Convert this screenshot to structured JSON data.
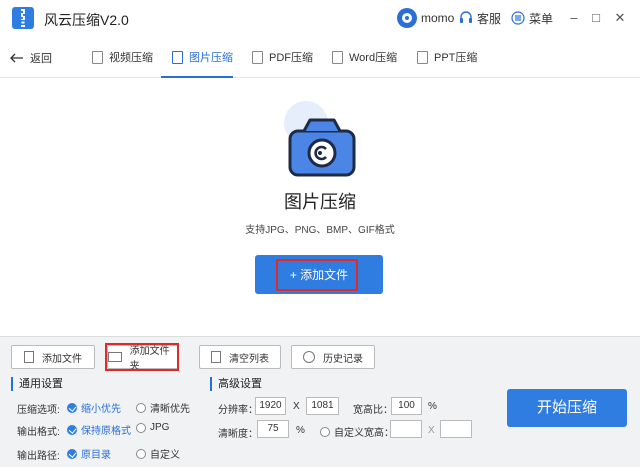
{
  "app": {
    "title": "风云压缩V2.0",
    "user": "momo",
    "service_label": "客服",
    "menu_label": "菜单",
    "minimize": "–",
    "maximize": "□",
    "close": "✕",
    "accent_color": "#2f7de1"
  },
  "tabs": {
    "back_label": "返回",
    "items": [
      {
        "label": "视频压缩",
        "icon": "video-file-icon"
      },
      {
        "label": "图片压缩",
        "icon": "image-file-icon",
        "active": true
      },
      {
        "label": "PDF压缩",
        "icon": "pdf-file-icon"
      },
      {
        "label": "Word压缩",
        "icon": "word-file-icon"
      },
      {
        "label": "PPT压缩",
        "icon": "ppt-file-icon"
      }
    ]
  },
  "main": {
    "title": "图片压缩",
    "subtitle": "支持JPG、PNG、BMP、GIF格式",
    "add_button": "+ 添加文件"
  },
  "toolbar": {
    "add_file": "添加文件",
    "add_folder": "添加文件夹",
    "clear_list": "清空列表",
    "history": "历史记录"
  },
  "general": {
    "title": "通用设置",
    "compress_label": "压缩选项:",
    "compress_opt1": "缩小优先",
    "compress_opt2": "清晰优先",
    "format_label": "输出格式:",
    "format_opt1": "保持原格式",
    "format_opt2": "JPG",
    "path_label": "输出路径:",
    "path_opt1": "原目录",
    "path_opt2": "自定义"
  },
  "advanced": {
    "title": "高级设置",
    "resolution_label": "分辨率：",
    "width": "1920",
    "x_sep": "X",
    "height": "1081",
    "ratio_label": "宽高比：",
    "ratio": "100",
    "percent": "%",
    "clarity_label": "清晰度：",
    "clarity": "75",
    "custom_label": "自定义宽高：",
    "custom_w": "",
    "custom_h": ""
  },
  "start_button": "开始压缩"
}
